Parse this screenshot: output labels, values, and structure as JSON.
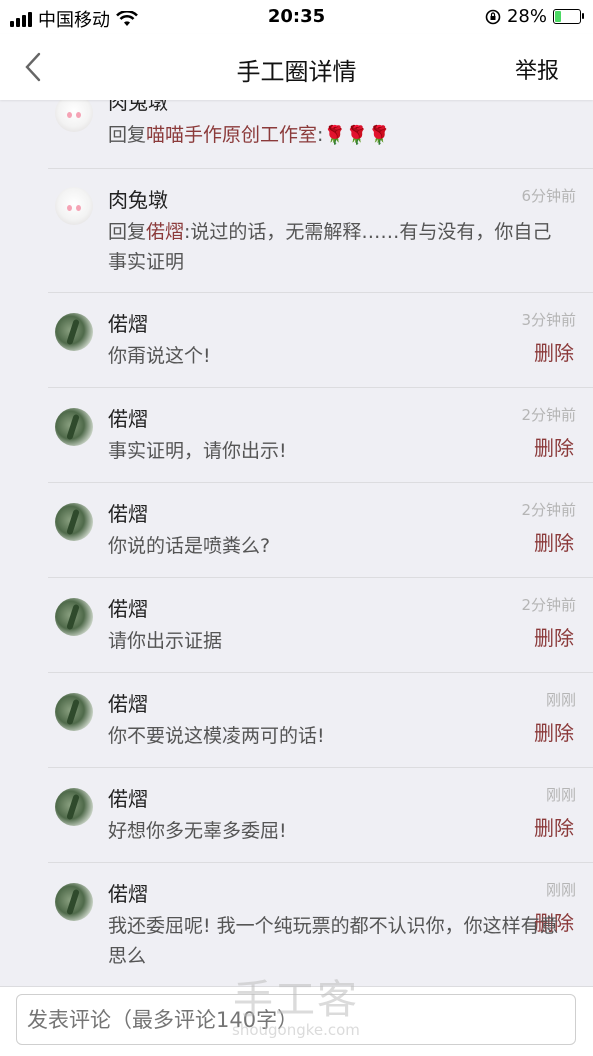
{
  "status_bar": {
    "carrier": "中国移动",
    "time": "20:35",
    "battery": "28%",
    "battery_level": 0.28
  },
  "nav": {
    "title": "手工圈详情",
    "report": "举报"
  },
  "comments": [
    {
      "name": "肉兔墩",
      "reply_prefix": "回复",
      "reply_to": "喵喵手作原创工作室",
      "text": ":",
      "emoji": "🌹🌹🌹",
      "time": "",
      "delete": "",
      "avatar": "rabbit-avatar"
    },
    {
      "name": "肉兔墩",
      "reply_prefix": "回复",
      "reply_to": "偌熠",
      "text": ":说过的话，无需解释……有与没有，你自己事实证明",
      "time": "6分钟前",
      "delete": "",
      "avatar": "rabbit-avatar"
    },
    {
      "name": "偌熠",
      "text": "你甭说这个!",
      "time": "3分钟前",
      "delete": "删除",
      "avatar": "plant-avatar"
    },
    {
      "name": "偌熠",
      "text": "事实证明，请你出示!",
      "time": "2分钟前",
      "delete": "删除",
      "avatar": "plant-avatar"
    },
    {
      "name": "偌熠",
      "text": "你说的话是喷粪么?",
      "time": "2分钟前",
      "delete": "删除",
      "avatar": "plant-avatar"
    },
    {
      "name": "偌熠",
      "text": "请你出示证据",
      "time": "2分钟前",
      "delete": "删除",
      "avatar": "plant-avatar"
    },
    {
      "name": "偌熠",
      "text": "你不要说这模凌两可的话!",
      "time": "刚刚",
      "delete": "删除",
      "avatar": "plant-avatar"
    },
    {
      "name": "偌熠",
      "text": "好想你多无辜多委屈!",
      "time": "刚刚",
      "delete": "删除",
      "avatar": "plant-avatar"
    },
    {
      "name": "偌熠",
      "text": "我还委屈呢! 我一个纯玩票的都不认识你，你这样有意思么",
      "time": "刚刚",
      "delete": "删除",
      "avatar": "plant-avatar"
    }
  ],
  "comment_input": {
    "placeholder": "发表评论（最多评论140字）"
  },
  "watermark": {
    "cn": "手工客",
    "en": "shougongke.com"
  }
}
